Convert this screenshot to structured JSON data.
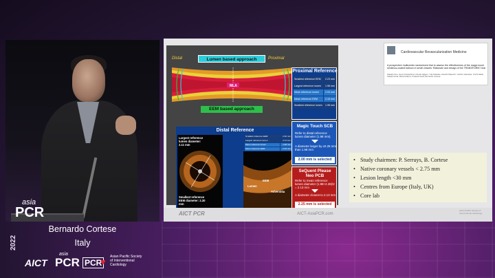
{
  "speaker": {
    "name": "Bernardo Cortese",
    "country": "Italy",
    "podium_logo_asia": "asia",
    "podium_logo_pcr": "PCR"
  },
  "branding": {
    "year": "2022",
    "aict": "AICT",
    "asia": "asia",
    "pcr": "PCR",
    "pcr_box": "PCR",
    "society": "Asian Pacific Society of Interventional Cardiology"
  },
  "slide": {
    "distal_label": "Distal",
    "proximal_label": "Proximal",
    "lumen_banner": "Lumen based approach",
    "eem_banner": "EEM based approach",
    "mla_label": "MLA",
    "proximal_reference": {
      "title": "Proximal Reference",
      "rows": [
        {
          "key": "Smallest reference EEM",
          "value": "2.23 mm",
          "highlight": false
        },
        {
          "key": "Largest reference lumen",
          "value": "1.98 mm",
          "highlight": false
        },
        {
          "key": "Mean reference lumen",
          "value": "2.03 mm",
          "highlight": true
        },
        {
          "key": "Mean reference EEM",
          "value": "2.15 mm",
          "highlight": true
        },
        {
          "key": "Smallest reference lumen",
          "value": "1.98 mm",
          "highlight": false
        }
      ]
    },
    "distal_reference": {
      "title": "Distal Reference",
      "oct_label_top": "Largest reference lumen diameter: 2.11 mm",
      "oct_label_bottom": "Smallest reference EEM diameter: 2.30 mm",
      "rows": [
        {
          "key": "Smallest reference EEM",
          "value": "2.30 mm",
          "highlight": false
        },
        {
          "key": "Largest reference lumen",
          "value": "2.11 mm",
          "highlight": false
        },
        {
          "key": "Mean reference lumen",
          "value": "1.98 mm",
          "highlight": true
        },
        {
          "key": "Mean reference EEM",
          "value": "2.15 mm",
          "highlight": true
        },
        {
          "key": "Smallest reference lumen",
          "value": "1.85 mm",
          "highlight": false
        }
      ],
      "oct2_labels": [
        "Lumen",
        "EEM",
        "Adventitia"
      ]
    },
    "magic_touch": {
      "title": "Magic Touch SCB",
      "text1": "Refer to distal reference lumen diameter (1.98 mm)",
      "text2": "A diameter larger by ≤0.25 mm than 1.98 mm",
      "result": "2.00 mm is selected"
    },
    "sequent": {
      "title": "SeQuent Please Neo PCB",
      "text1": "Refer to mean reference lumen diameter (1.98+2.28)/2 = 2.13 mm",
      "text2": "A diameter closest to 2.13 mm",
      "result": "2.25 mm is selected"
    },
    "paper": {
      "journal": "Cardiovascular Revascularization Medicine",
      "title": "A prospective multicenter randomized trial to assess the effectiveness of the magic touch sirolimus-coated balloon in small vessels: Rationale and design of the TRANSFORM I trial",
      "authors": "Takashi Ono, Ayumi Kawashima, Hirooki Higami, Yuki Kataoka, Atsushi Takeuchi, Yoichiro Hanaoka, Yoichi Sakai, Takashi Hirai, Daniel Adams, Frederik Giehl, Bernardo Cortese"
    },
    "bullets": [
      "Study chairmen: P. Serruys, B. Cortese",
      "Native coronary vessels < 2.75 mm",
      "Lesion length <30 mm",
      "Centres from Europe (Italy, UK)",
      "Core lab"
    ],
    "footer": {
      "aict": "AICT PCR",
      "url": "AICT-AsiaPCR.com",
      "society": "Asian Pacific Society of Interventional Cardiology"
    }
  },
  "colors": {
    "panel_blue": "#0d3d8c",
    "panel_red": "#b51d1d",
    "lumen_cyan": "#2eccd9",
    "eem_green": "#2ebf4a",
    "bullet_bg": "#f2f2dc"
  }
}
